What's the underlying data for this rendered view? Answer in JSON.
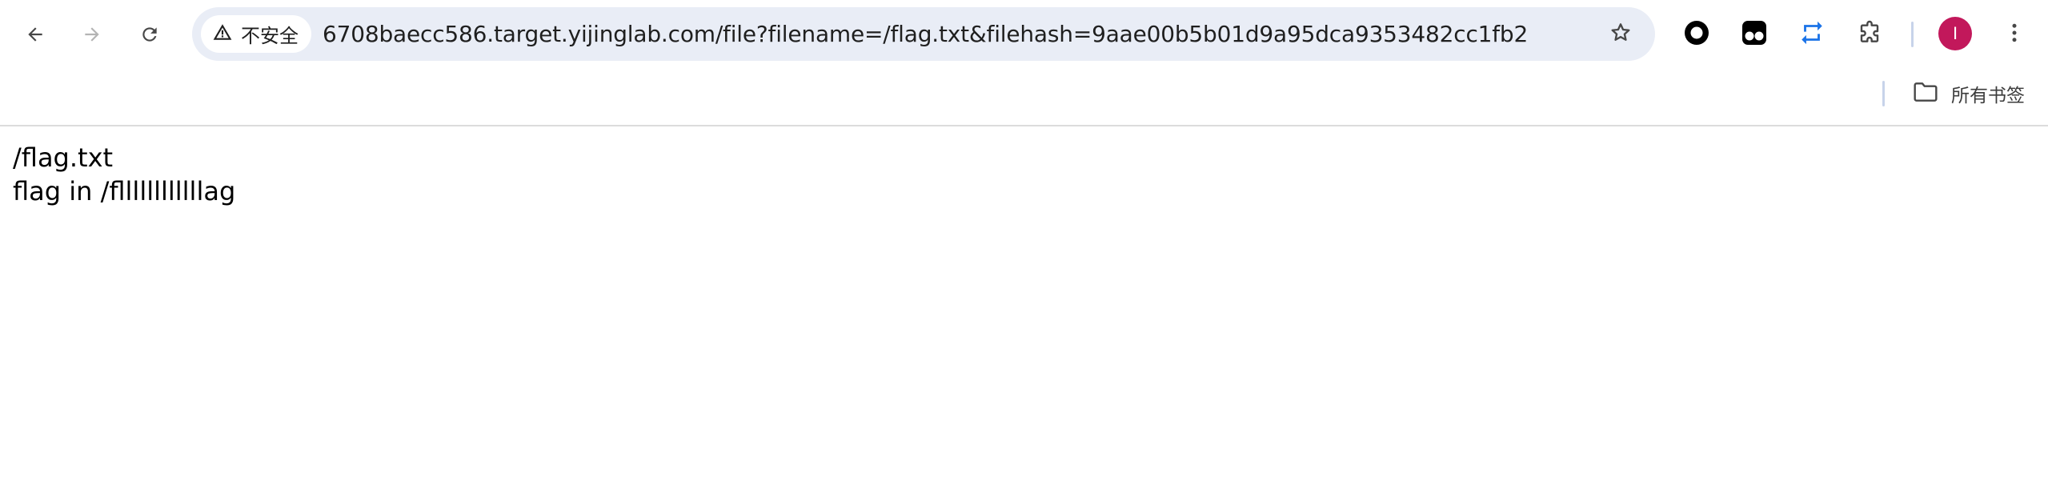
{
  "toolbar": {
    "back_icon": "arrow-left-icon",
    "forward_icon": "arrow-right-icon",
    "reload_icon": "reload-icon"
  },
  "omnibox": {
    "security_icon": "warning-triangle-icon",
    "security_label": "不安全",
    "url": "6708baecc586.target.yijinglab.com/file?filename=/flag.txt&filehash=9aae00b5b01d9a95dca9353482cc1fb2",
    "bookmark_icon": "star-icon"
  },
  "extensions": [
    {
      "icon": "circle-ring-extension-icon"
    },
    {
      "icon": "tampermonkey-extension-icon"
    },
    {
      "icon": "repeat-arrows-extension-icon"
    },
    {
      "icon": "puzzle-extensions-icon"
    }
  ],
  "profile": {
    "initial": "I",
    "color": "#c2185b"
  },
  "menu_icon": "three-dot-menu-icon",
  "bookmarks_bar": {
    "all_bookmarks_icon": "folder-icon",
    "all_bookmarks_label": "所有书签"
  },
  "page": {
    "lines": [
      "/flag.txt",
      "flag in /fllllllllllllag"
    ]
  },
  "colors": {
    "omnibox_bg": "#e9edf6",
    "accent_blue": "#1a73e8"
  }
}
